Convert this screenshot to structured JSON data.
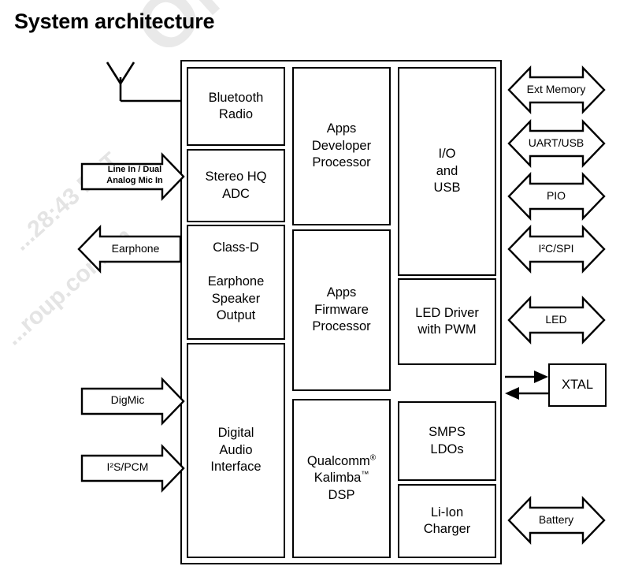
{
  "page": {
    "title": "System architecture",
    "watermark_lines": [
      "OMM",
      "...28:43 PST",
      "...roup.com.cn"
    ]
  },
  "diagram": {
    "type": "block-diagram",
    "chip_blocks": {
      "left_column": [
        {
          "id": "bluetooth-radio",
          "label": "Bluetooth\nRadio"
        },
        {
          "id": "stereo-hq-adc",
          "label": "Stereo HQ\nADC"
        },
        {
          "id": "class-d-earphone",
          "label": "Class-D\n\nEarphone\nSpeaker\nOutput"
        },
        {
          "id": "digital-audio-interface",
          "label": "Digital\nAudio\nInterface"
        }
      ],
      "middle_column": [
        {
          "id": "apps-developer-processor",
          "label": "Apps\nDeveloper\nProcessor"
        },
        {
          "id": "apps-firmware-processor",
          "label": "Apps\nFirmware\nProcessor"
        },
        {
          "id": "kalimba-dsp",
          "label_parts": [
            "Qualcomm",
            "®",
            "Kalimba",
            "™",
            "DSP"
          ]
        }
      ],
      "right_column": [
        {
          "id": "io-and-usb",
          "label": "I/O\nand\nUSB"
        },
        {
          "id": "led-driver",
          "label": "LED Driver\nwith PWM"
        },
        {
          "id": "smps-ldos",
          "label": "SMPS\nLDOs"
        },
        {
          "id": "li-ion-charger",
          "label": "Li-Ion\nCharger"
        }
      ]
    },
    "external_blocks": [
      {
        "id": "xtal",
        "label": "XTAL"
      }
    ],
    "left_ports": [
      {
        "id": "line-in-dual-analog-mic-in",
        "label": "Line In / Dual\nAnalog Mic In",
        "direction": "in",
        "style": "small"
      },
      {
        "id": "earphone",
        "label": "Earphone",
        "direction": "out",
        "style": "normal"
      },
      {
        "id": "digmic",
        "label": "DigMic",
        "direction": "in",
        "style": "normal"
      },
      {
        "id": "i2s-pcm",
        "label": "I²S/PCM",
        "direction": "in",
        "style": "normal"
      }
    ],
    "right_ports": [
      {
        "id": "ext-memory",
        "label": "Ext Memory",
        "direction": "bidirectional"
      },
      {
        "id": "uart-usb",
        "label": "UART/USB",
        "direction": "bidirectional"
      },
      {
        "id": "pio",
        "label": "PIO",
        "direction": "bidirectional"
      },
      {
        "id": "i2c-spi",
        "label": "I²C/SPI",
        "direction": "bidirectional"
      },
      {
        "id": "led",
        "label": "LED",
        "direction": "bidirectional"
      },
      {
        "id": "battery",
        "label": "Battery",
        "direction": "bidirectional"
      }
    ],
    "antenna": {
      "id": "antenna",
      "label": ""
    },
    "colors": {
      "stroke": "#000000",
      "background": "#ffffff",
      "watermark": "#e9e9e9"
    }
  }
}
